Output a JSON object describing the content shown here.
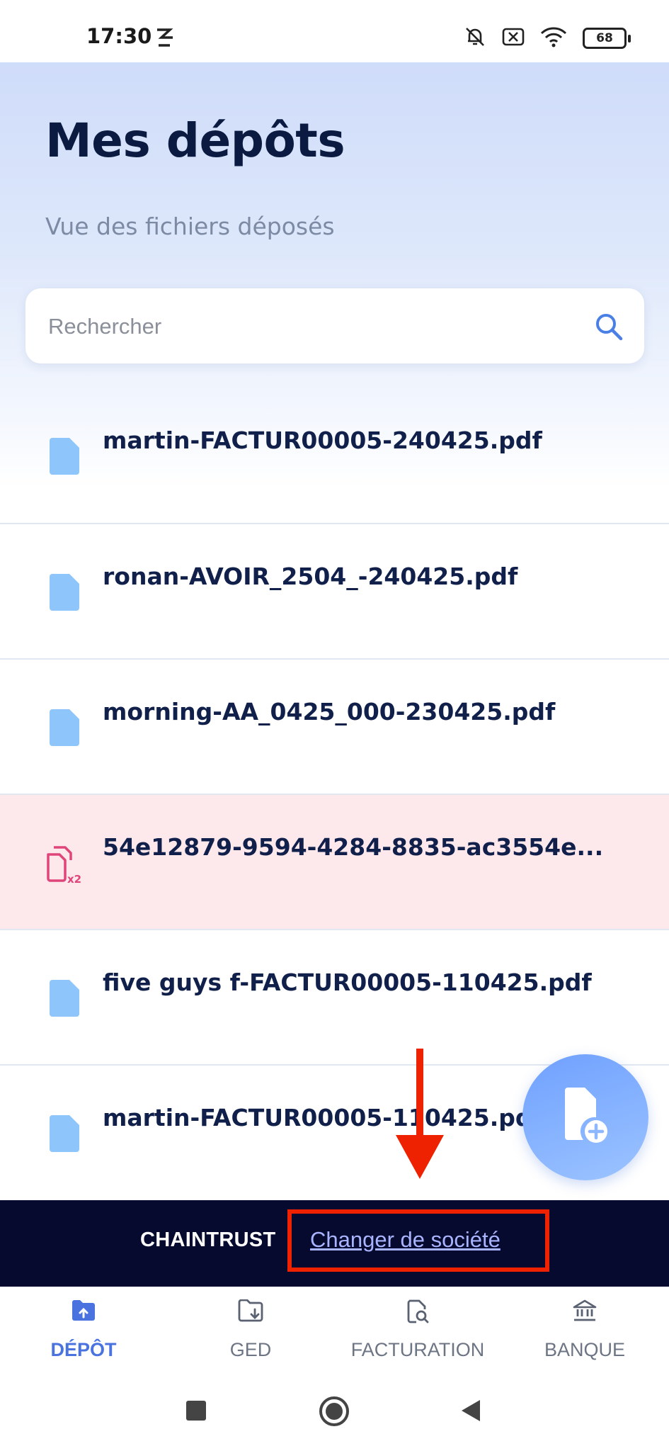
{
  "status_bar": {
    "time": "17:30",
    "battery": "68"
  },
  "header": {
    "title": "Mes dépôts",
    "subtitle": "Vue des fichiers déposés"
  },
  "search": {
    "placeholder": "Rechercher"
  },
  "files": [
    {
      "name": "martin-FACTUR00005-240425.pdf",
      "status": "ok"
    },
    {
      "name": "ronan-AVOIR_2504_-240425.pdf",
      "status": "ok"
    },
    {
      "name": "morning-AA_0425_000-230425.pdf",
      "status": "ok"
    },
    {
      "name": "54e12879-9594-4284-8835-ac3554e...",
      "status": "duplicate"
    },
    {
      "name": "five guys f-FACTUR00005-110425.pdf",
      "status": "ok"
    },
    {
      "name": "martin-FACTUR00005-110425.pdf",
      "status": "ok"
    }
  ],
  "company_bar": {
    "brand": "CHAINTRUST",
    "change_company": "Changer de société"
  },
  "bottom_nav": {
    "items": [
      {
        "label": "DÉPÔT",
        "icon": "folder-upload-icon",
        "active": true
      },
      {
        "label": "GED",
        "icon": "folder-download-icon",
        "active": false
      },
      {
        "label": "FACTURATION",
        "icon": "document-search-icon",
        "active": false
      },
      {
        "label": "BANQUE",
        "icon": "bank-icon",
        "active": false
      }
    ]
  },
  "colors": {
    "accent": "#4a73e0",
    "file_icon": "#8ec5fa",
    "error_bg": "#fde8ec",
    "error_icon": "#e0457a",
    "company_bar_bg": "#060a2e",
    "annotation": "#ee2200"
  }
}
